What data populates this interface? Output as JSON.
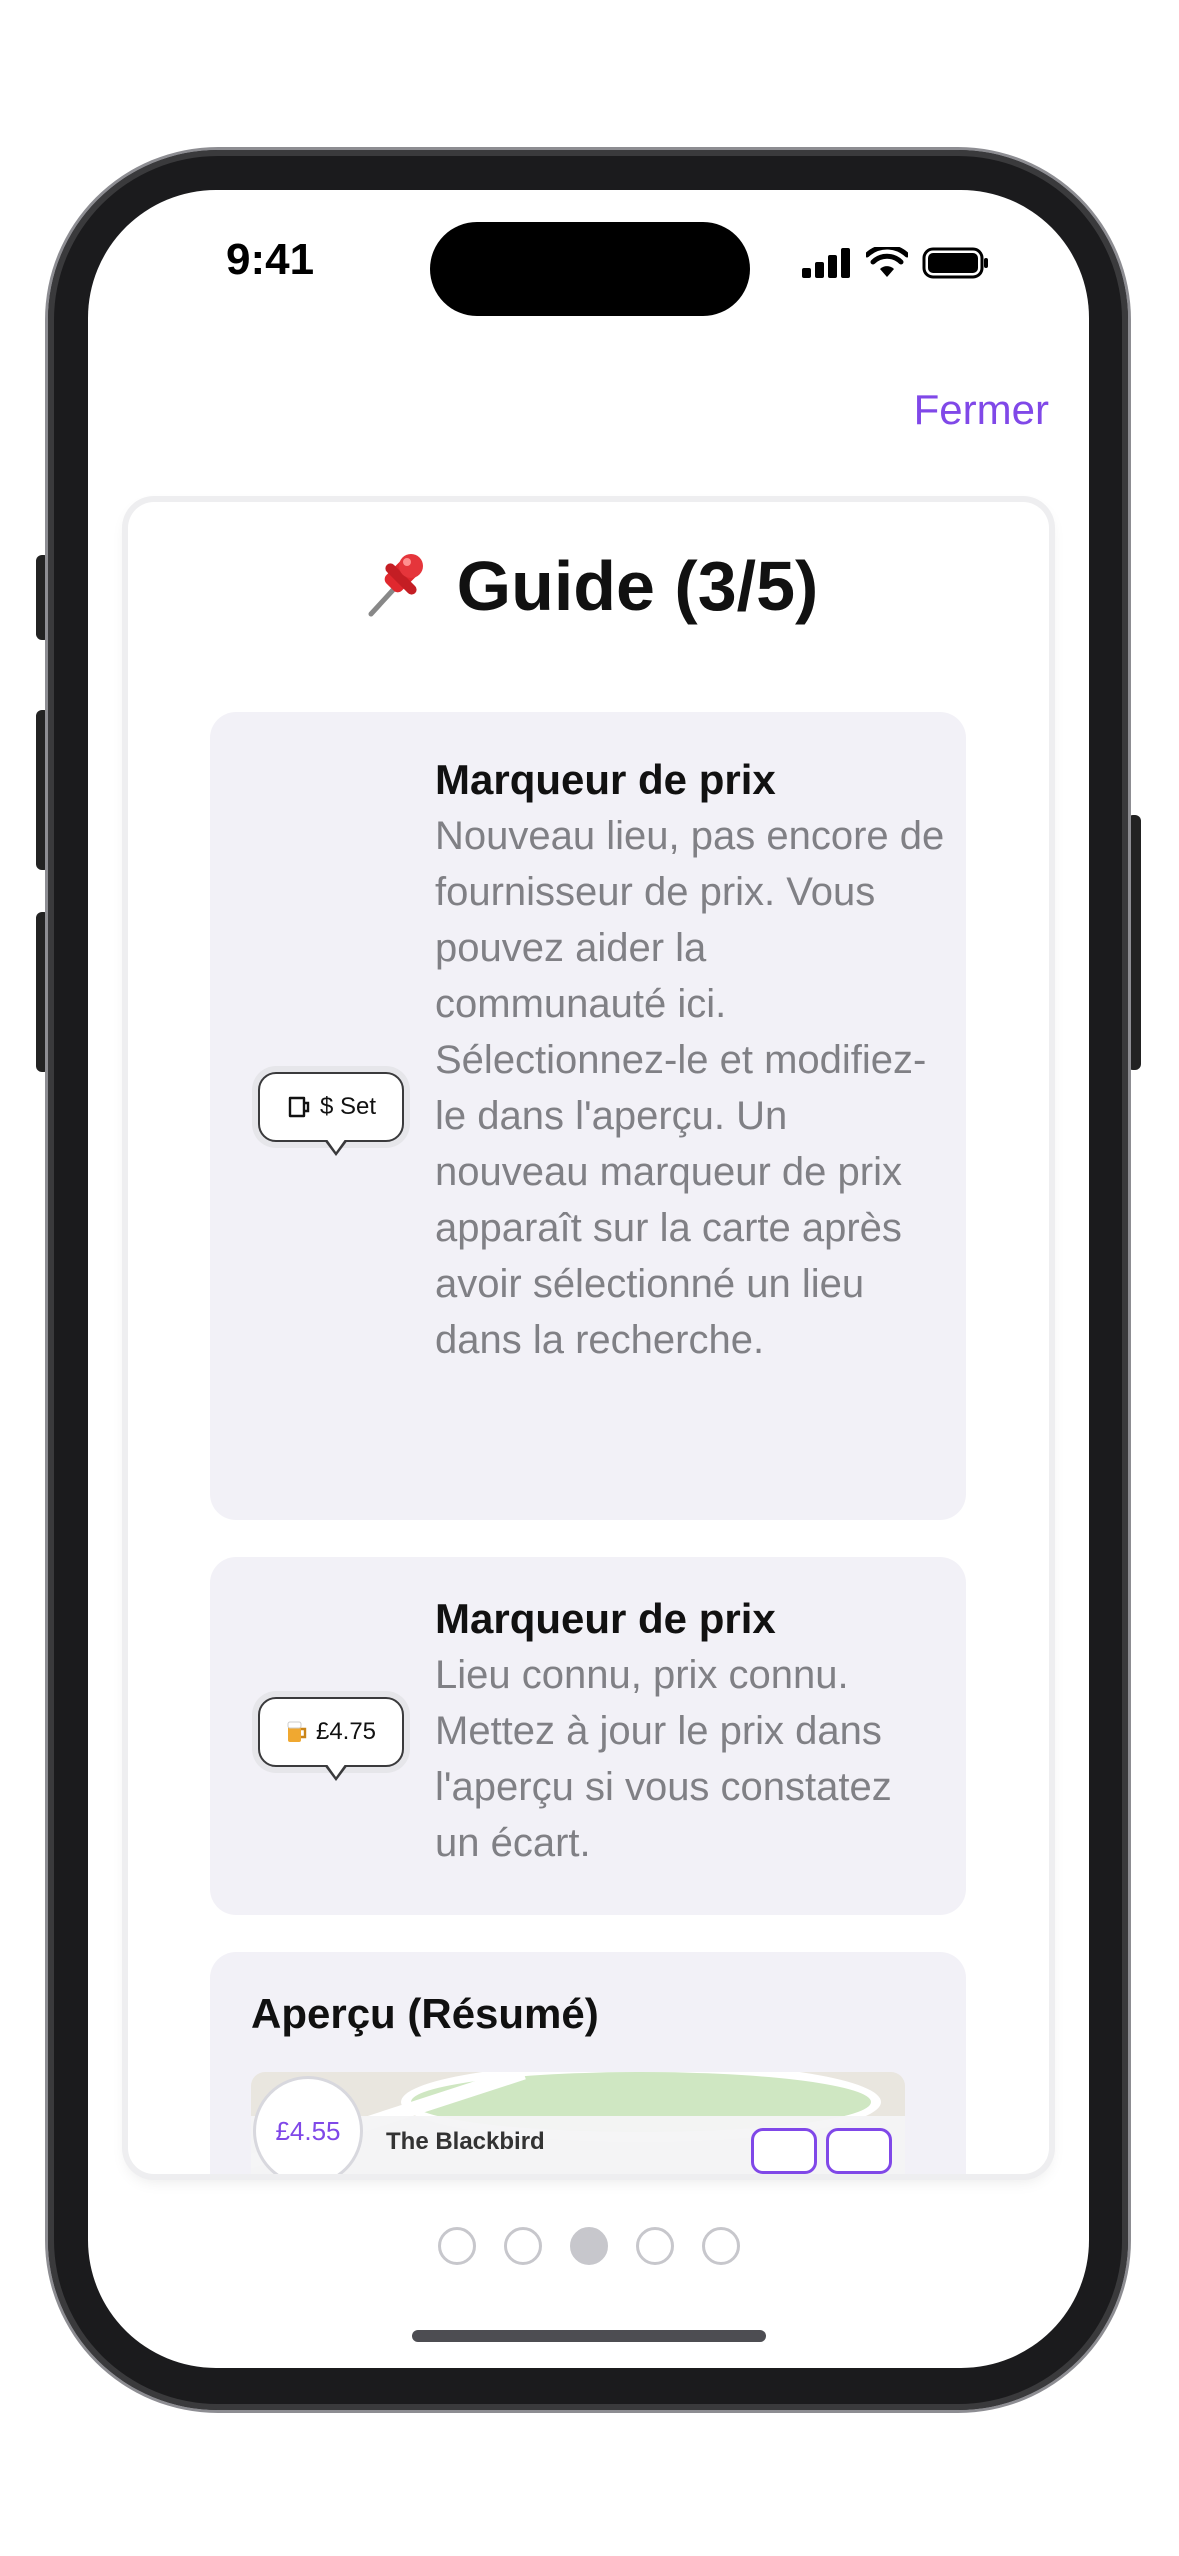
{
  "status_bar": {
    "time": "9:41"
  },
  "header": {
    "close_label": "Fermer"
  },
  "guide": {
    "title": "Guide (3/5)",
    "sections": [
      {
        "marker_label": "$ Set",
        "title": "Marqueur de prix",
        "body": "Nouveau lieu, pas encore de fournisseur de prix. Vous pouvez aider la communauté ici. Sélectionnez-le et modifiez-le dans l'aperçu. Un nouveau marqueur de prix apparaît sur la carte après avoir sélectionné un lieu dans la recherche."
      },
      {
        "marker_label": "£4.75",
        "title": "Marqueur de prix",
        "body": "Lieu connu, prix connu. Mettez à jour le prix dans l'aperçu si vous constatez un écart."
      }
    ],
    "summary": {
      "title": "Aperçu (Résumé)",
      "price": "£4.55",
      "place": "The Blackbird"
    }
  },
  "pagination": {
    "pages": 5,
    "current": 3
  },
  "colors": {
    "accent": "#8048e8",
    "section_bg": "#f2f1f7",
    "body_text": "#808085"
  }
}
